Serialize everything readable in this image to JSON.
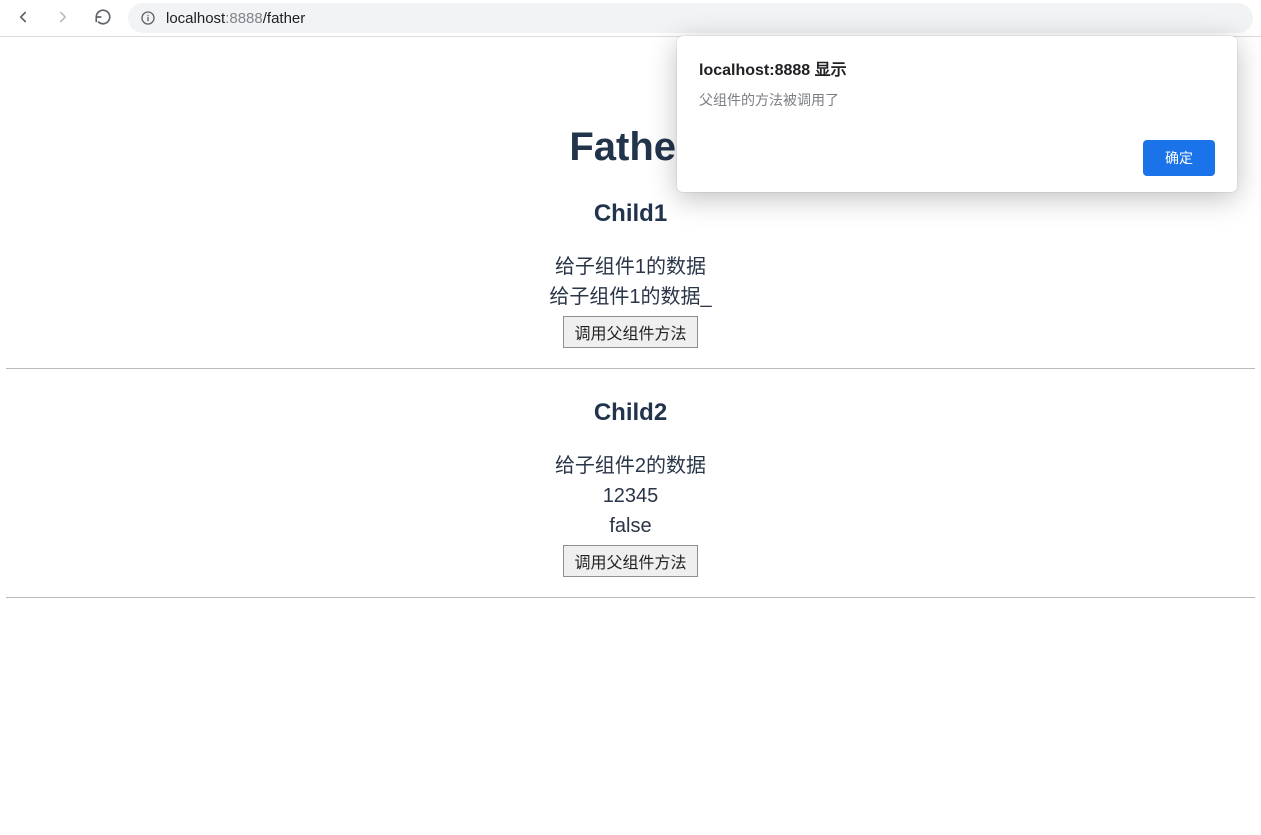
{
  "browser": {
    "url": {
      "host": "localhost",
      "port": ":8888",
      "path": "/father"
    }
  },
  "alert": {
    "title": "localhost:8888 显示",
    "message": "父组件的方法被调用了",
    "ok_label": "确定"
  },
  "page": {
    "father_title": "Father",
    "child1": {
      "title": "Child1",
      "line1": "给子组件1的数据",
      "line2": "给子组件1的数据_",
      "button_label": "调用父组件方法"
    },
    "child2": {
      "title": "Child2",
      "line1": "给子组件2的数据",
      "line2": "12345",
      "line3": "false",
      "button_label": "调用父组件方法"
    }
  }
}
